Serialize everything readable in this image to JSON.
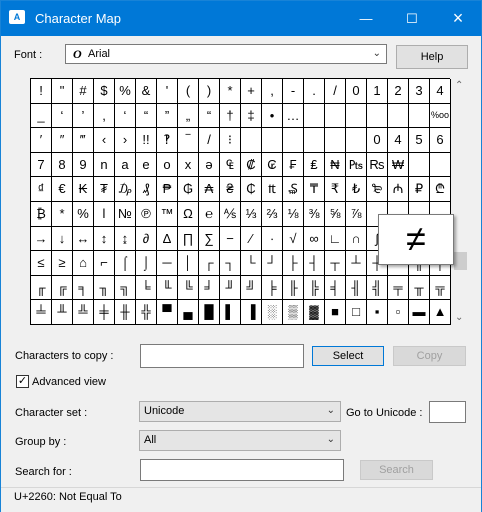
{
  "window": {
    "title": "Character Map"
  },
  "titlebar": {
    "minimize": "—",
    "maximize": "☐",
    "close": "×"
  },
  "font": {
    "label": "Font :",
    "icon_glyph": "O",
    "value": "Arial",
    "help_label": "Help"
  },
  "grid": {
    "rows": [
      [
        "!",
        "\"",
        "#",
        "$",
        "%",
        "&",
        "'",
        "(",
        ")",
        "*",
        "+",
        ",",
        "-",
        ".",
        "/",
        "0",
        "1",
        "2",
        "3",
        "4"
      ],
      [
        "_",
        "‘",
        "’",
        ",",
        "‘",
        "“",
        "”",
        "„",
        "“",
        "†",
        "‡",
        "•",
        "…",
        "",
        "",
        "",
        "",
        "",
        "",
        "%oo"
      ],
      [
        "′",
        "″",
        "‴",
        "‹",
        "›",
        "!!",
        "‽",
        "‾",
        "/",
        "⁝",
        "",
        "",
        "",
        "",
        "",
        "",
        "0",
        "4",
        "5",
        "6"
      ],
      [
        "7",
        "8",
        "9",
        "n",
        "a",
        "e",
        "o",
        "x",
        "ə",
        "₠",
        "₡",
        "₢",
        "₣",
        "₤",
        "₦",
        "₧",
        "₨",
        "₩",
        "",
        ""
      ],
      [
        "₫",
        "€",
        "₭",
        "₮",
        "₯",
        "₰",
        "₱",
        "₲",
        "₳",
        "₴",
        "₵",
        "₶",
        "₷",
        "₸",
        "₹",
        "₺",
        "₻",
        "₼",
        "₽",
        "₾"
      ],
      [
        "₿",
        "*",
        "%",
        "l",
        "№",
        "℗",
        "™",
        "Ω",
        "℮",
        "⅍",
        "⅓",
        "⅔",
        "⅛",
        "⅜",
        "⅝",
        "⅞",
        "",
        "",
        "",
        ""
      ],
      [
        "→",
        "↓",
        "↔",
        "↕",
        "↨",
        "∂",
        "∆",
        "∏",
        "∑",
        "−",
        "∕",
        "∙",
        "√",
        "∞",
        "∟",
        "∩",
        "∫",
        "≈",
        "≠",
        "≡"
      ],
      [
        "≤",
        "≥",
        "⌂",
        "⌐",
        "⌠",
        "⌡",
        "─",
        "│",
        "┌",
        "┐",
        "└",
        "┘",
        "├",
        "┤",
        "┬",
        "┴",
        "┼",
        "═",
        "║",
        "╒"
      ],
      [
        "╓",
        "╔",
        "╕",
        "╖",
        "╗",
        "╘",
        "╙",
        "╚",
        "╛",
        "╜",
        "╝",
        "╞",
        "╟",
        "╠",
        "╡",
        "╢",
        "╣",
        "╤",
        "╥",
        "╦"
      ],
      [
        "╧",
        "╨",
        "╩",
        "╪",
        "╫",
        "╬",
        "▀",
        "▄",
        "█",
        "▌",
        "▐",
        "░",
        "▒",
        "▓",
        "■",
        "□",
        "▪",
        "▫",
        "▬",
        "▲"
      ]
    ],
    "zoom_char": "≠"
  },
  "copy": {
    "label": "Characters to copy :",
    "value": "",
    "select_label": "Select",
    "copy_label": "Copy"
  },
  "advanced": {
    "label": "Advanced view",
    "checked": "✓"
  },
  "charset": {
    "label": "Character set :",
    "value": "Unicode",
    "goto_label": "Go to Unicode :",
    "goto_value": ""
  },
  "groupby": {
    "label": "Group by :",
    "value": "All"
  },
  "search": {
    "label": "Search for :",
    "value": "",
    "button_label": "Search"
  },
  "status": {
    "text": "U+2260: Not Equal To"
  }
}
